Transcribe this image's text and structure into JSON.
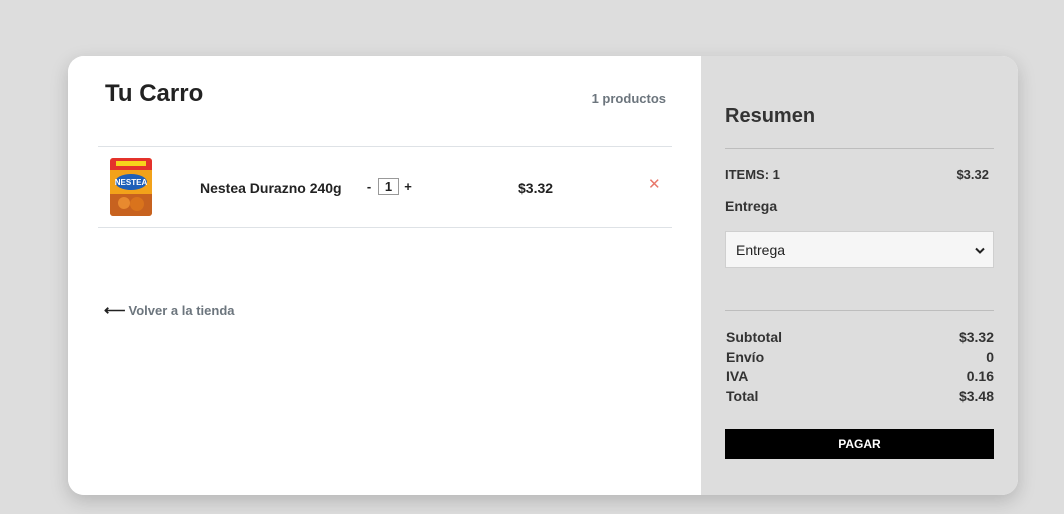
{
  "cart": {
    "title": "Tu Carro",
    "count": "1 productos",
    "items": [
      {
        "name": "Nestea Durazno 240g",
        "qty_minus": "-",
        "qty": "1",
        "qty_plus": "+",
        "price": "$3.32",
        "remove": "✕",
        "image_icon": "product-thumbnail"
      }
    ],
    "back_arrow": "⟵",
    "back_label": "Volver a la tienda"
  },
  "summary": {
    "title": "Resumen",
    "items_label": "ITEMS: 1",
    "items_value": "$3.32",
    "delivery_label": "Entrega",
    "delivery_select": "Entrega",
    "select_icon": "chevron-down-icon",
    "totals": [
      {
        "label": "Subtotal",
        "value": "$3.32"
      },
      {
        "label": "Envío",
        "value": "0"
      },
      {
        "label": "IVA",
        "value": "0.16"
      },
      {
        "label": "Total",
        "value": "$3.48"
      }
    ],
    "pay_label": "PAGAR"
  },
  "colors": {
    "page_bg": "#dddddd",
    "card_bg": "#ffffff",
    "summary_bg": "#dddddd",
    "pay_bg": "#000000",
    "remove_color": "#e8786b",
    "muted_text": "#6c757d"
  }
}
